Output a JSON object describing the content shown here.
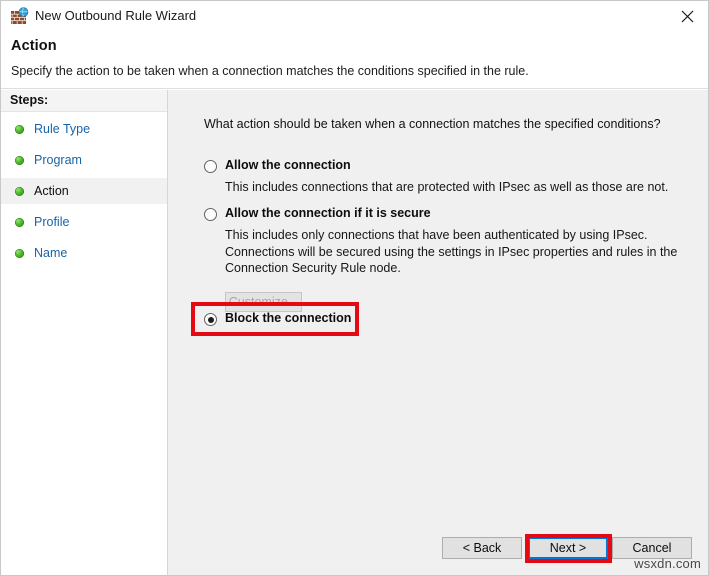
{
  "window": {
    "title": "New Outbound Rule Wizard",
    "icon": "firewall-brick-globe-icon",
    "close_label": "✕"
  },
  "header": {
    "title": "Action",
    "subtitle": "Specify the action to be taken when a connection matches the conditions specified in the rule."
  },
  "sidebar": {
    "heading": "Steps:",
    "items": [
      {
        "label": "Rule Type",
        "state": "completed"
      },
      {
        "label": "Program",
        "state": "completed"
      },
      {
        "label": "Action",
        "state": "current"
      },
      {
        "label": "Profile",
        "state": "completed"
      },
      {
        "label": "Name",
        "state": "completed"
      }
    ]
  },
  "main": {
    "question": "What action should be taken when a connection matches the specified conditions?",
    "options": [
      {
        "title": "Allow the connection",
        "description": "This includes connections that are protected with IPsec as well as those are not.",
        "selected": false
      },
      {
        "title": "Allow the connection if it is secure",
        "description": "This includes only connections that have been authenticated by using IPsec.  Connections will be secured using the settings in IPsec properties and rules in the Connection Security Rule node.",
        "selected": false
      },
      {
        "title": "Block the connection",
        "description": "",
        "selected": true
      }
    ],
    "customize_label": "Customize...",
    "customize_disabled": true
  },
  "footer": {
    "back_label": "< Back",
    "next_label": "Next >",
    "cancel_label": "Cancel"
  },
  "watermark": "wsxdn.com",
  "colors": {
    "annotation": "#e50914",
    "focus": "#0078d7",
    "link": "#1764a8",
    "content_bg": "#f0f0f0"
  }
}
